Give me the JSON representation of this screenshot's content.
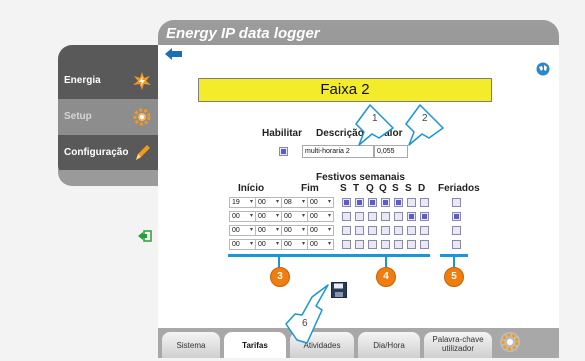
{
  "app": {
    "title": "Energy IP data logger"
  },
  "sidebar": {
    "items": [
      {
        "label": "Energia",
        "icon": "energy-icon"
      },
      {
        "label": "Setup",
        "icon": "gear-icon"
      },
      {
        "label": "Configuração",
        "icon": "pencil-icon"
      }
    ]
  },
  "banner": {
    "text": "Faixa 2"
  },
  "form": {
    "enable_label": "Habilitar",
    "description_label": "Descrição",
    "value_label": "Valor",
    "enable_checked": true,
    "description_value": "multi-horaria 2",
    "value_value": "0,055"
  },
  "schedule": {
    "festivos_label": "Festivos semanais",
    "start_label": "Início",
    "end_label": "Fim",
    "day_labels": [
      "S",
      "T",
      "Q",
      "Q",
      "S",
      "S",
      "D"
    ],
    "holidays_label": "Feriados",
    "rows": [
      {
        "start_h": "19",
        "start_m": "00",
        "end_h": "08",
        "end_m": "00",
        "days": [
          true,
          true,
          true,
          true,
          true,
          false,
          false
        ],
        "holiday": false
      },
      {
        "start_h": "00",
        "start_m": "00",
        "end_h": "00",
        "end_m": "00",
        "days": [
          false,
          false,
          false,
          false,
          false,
          true,
          true
        ],
        "holiday": true
      },
      {
        "start_h": "00",
        "start_m": "00",
        "end_h": "00",
        "end_m": "00",
        "days": [
          false,
          false,
          false,
          false,
          false,
          false,
          false
        ],
        "holiday": false
      },
      {
        "start_h": "00",
        "start_m": "00",
        "end_h": "00",
        "end_m": "00",
        "days": [
          false,
          false,
          false,
          false,
          false,
          false,
          false
        ],
        "holiday": false
      }
    ]
  },
  "callouts": {
    "c1": "1",
    "c2": "2",
    "c3": "3",
    "c4": "4",
    "c5": "5",
    "c6": "6"
  },
  "tabs": [
    {
      "label": "Sistema"
    },
    {
      "label": "Tarifas"
    },
    {
      "label": "Atividades"
    },
    {
      "label": "Dia/Hora"
    },
    {
      "label": "Palavra-chave utilizador"
    }
  ],
  "colors": {
    "accent": "#1a95d8",
    "callout": "#ef7d0f",
    "banner": "#f4ec2a"
  }
}
